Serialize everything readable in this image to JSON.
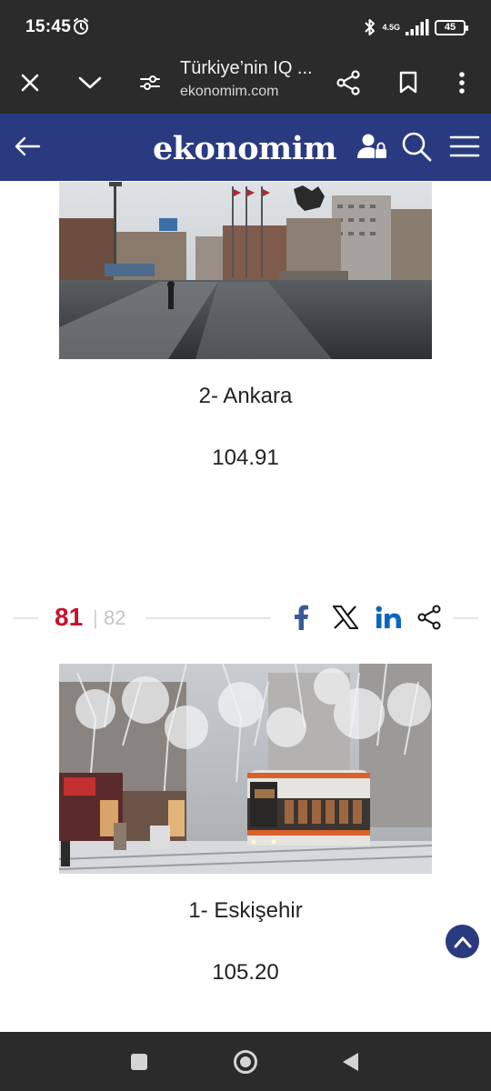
{
  "status_bar": {
    "time": "15:45",
    "network": "4.5G",
    "battery": "45",
    "icons": [
      "alarm-icon",
      "bluetooth-icon",
      "signal-icon",
      "battery-icon"
    ]
  },
  "browser": {
    "title": "Türkiye’nin IQ ...",
    "domain": "ekonomim.com",
    "icons": [
      "close-icon",
      "chevron-down-icon",
      "page-info-icon",
      "share-icon",
      "bookmark-icon",
      "more-vert-icon"
    ]
  },
  "site_header": {
    "logo": "ekonomim",
    "background": "#2a3a80",
    "icons": [
      "back-arrow-icon",
      "user-lock-icon",
      "search-icon",
      "menu-icon"
    ]
  },
  "slides": [
    {
      "caption": "2- Ankara",
      "score": "104.91"
    },
    {
      "caption": "1- Eskişehir",
      "score": "105.20"
    }
  ],
  "pagination": {
    "current": "81",
    "separator": "|",
    "total": "82",
    "current_color": "#c8102e"
  },
  "share_icons": [
    "facebook-icon",
    "x-icon",
    "linkedin-icon",
    "share-icon"
  ],
  "colors": {
    "facebook": "#3b5998",
    "linkedin": "#0a66c2",
    "brand": "#2a3a80"
  }
}
